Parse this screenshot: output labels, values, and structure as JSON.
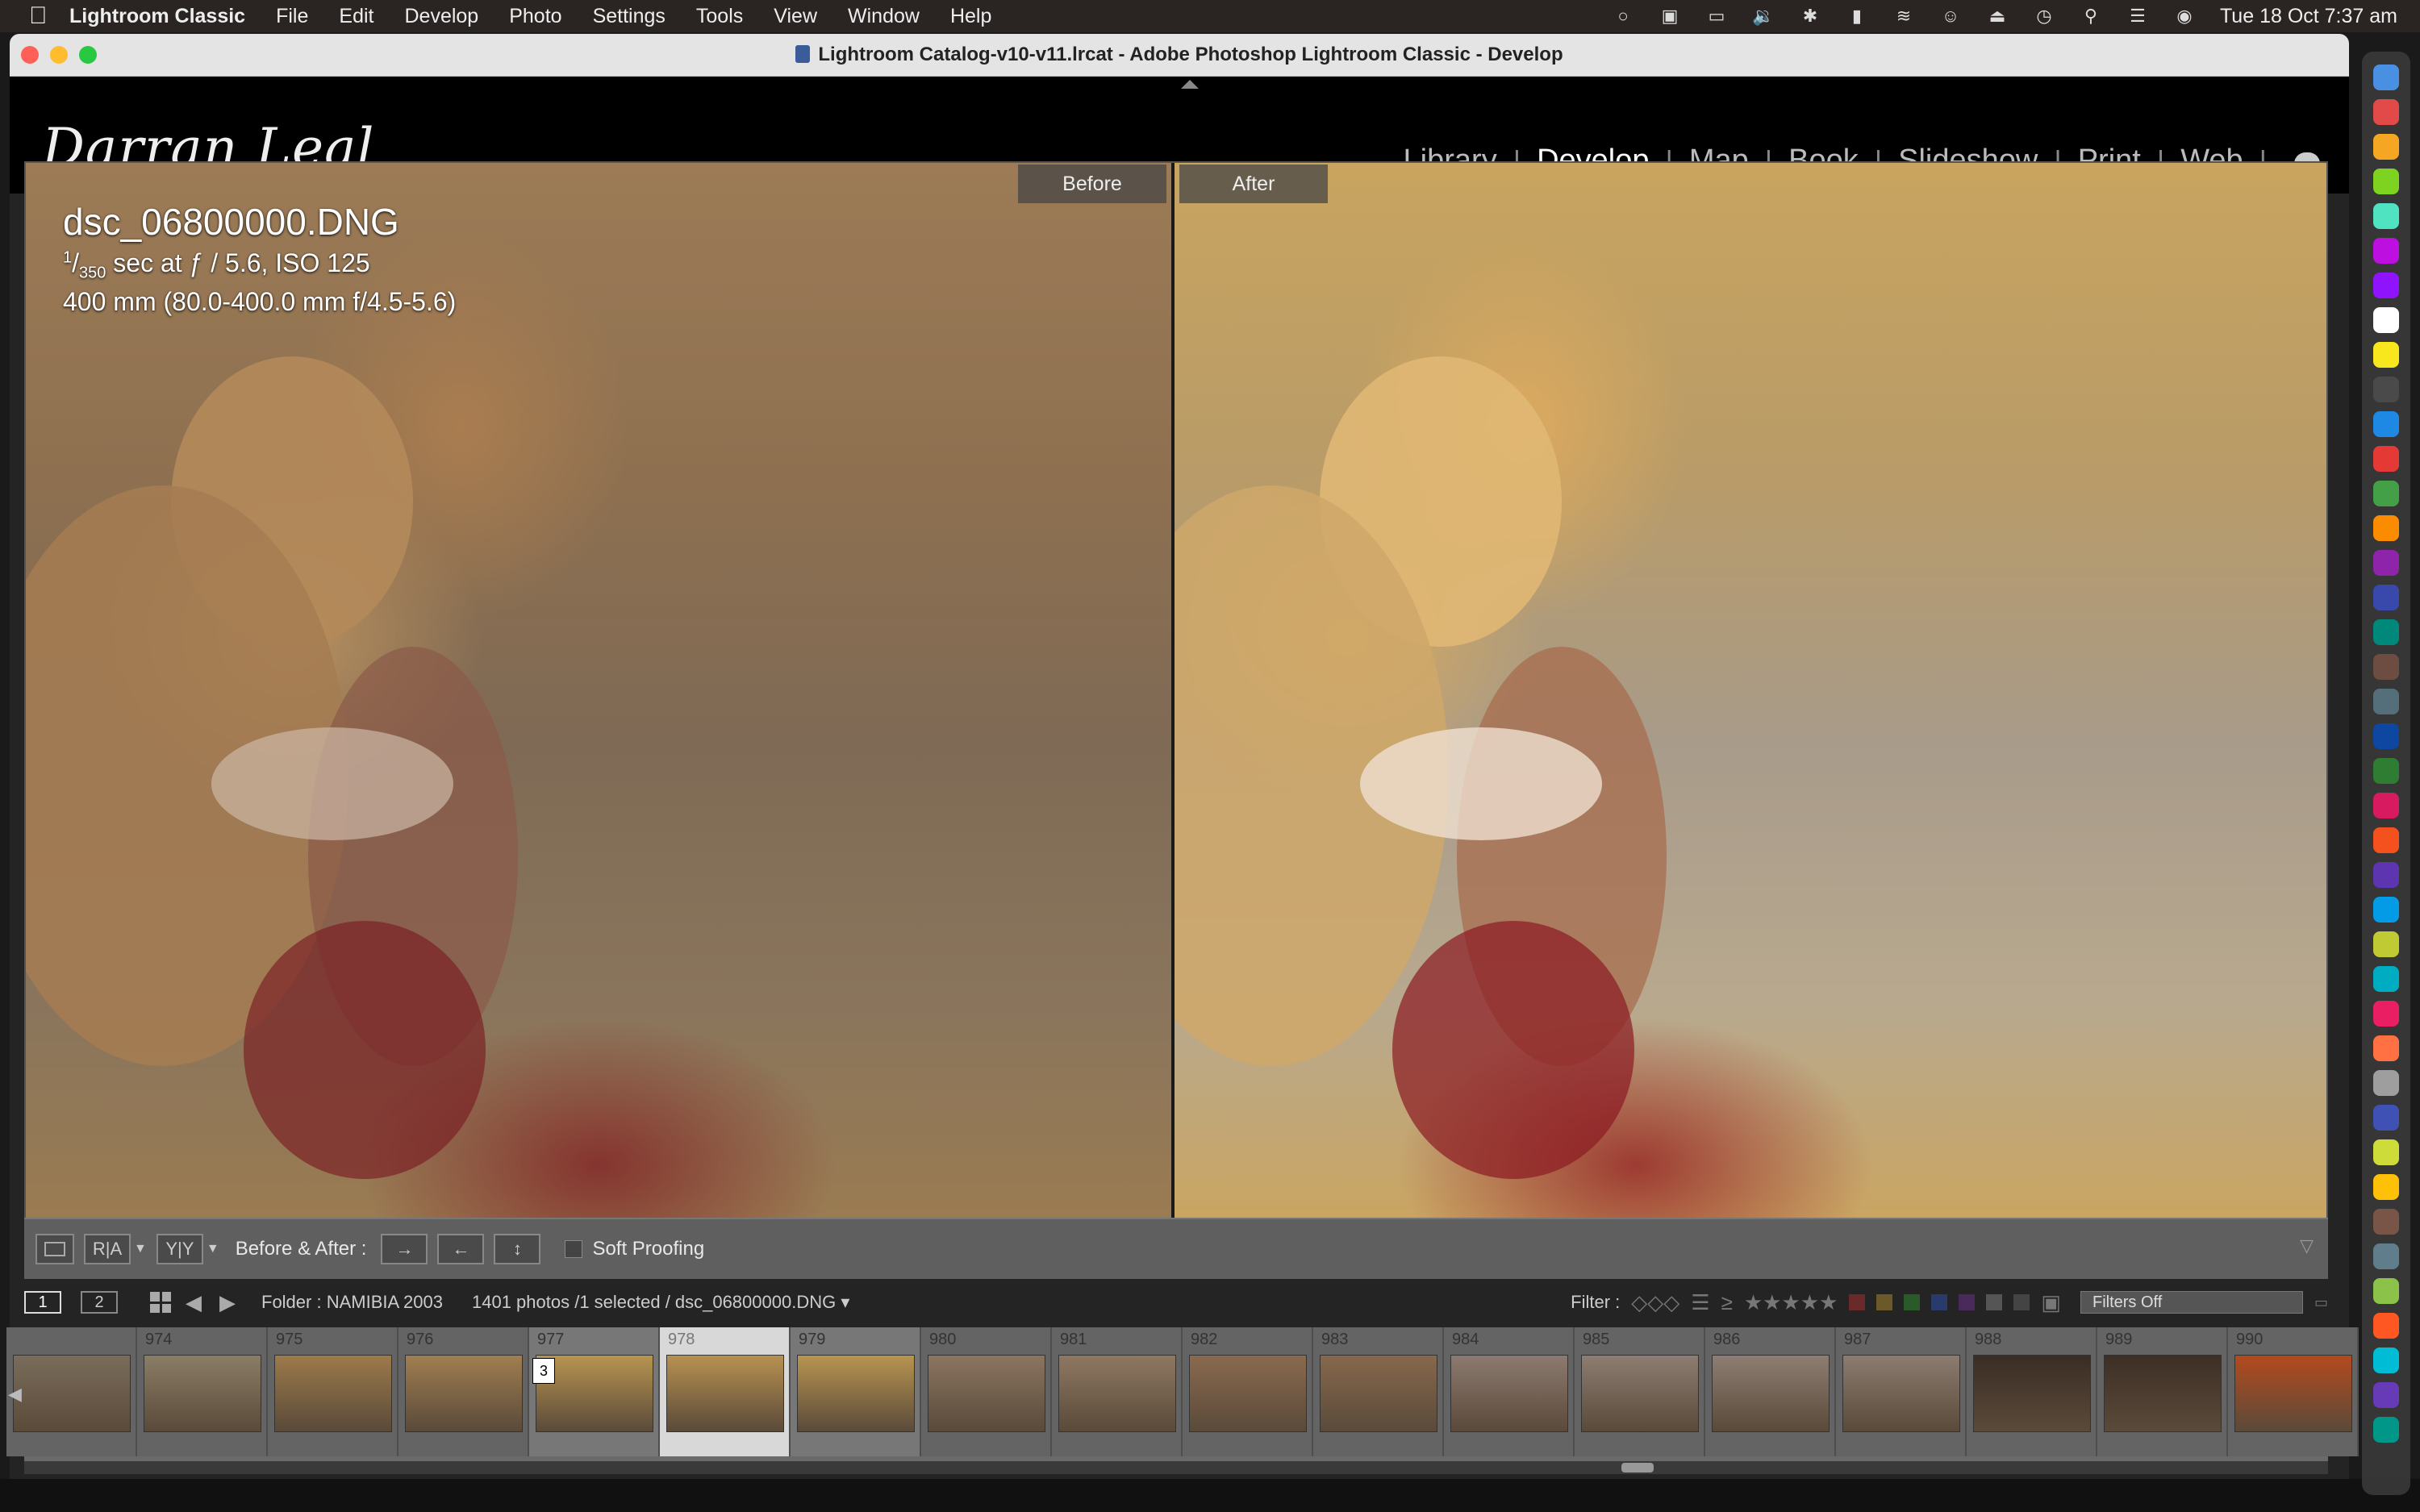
{
  "menubar": {
    "app_name": "Lightroom Classic",
    "items": [
      "File",
      "Edit",
      "Develop",
      "Photo",
      "Settings",
      "Tools",
      "View",
      "Window",
      "Help"
    ],
    "datetime": "Tue 18 Oct  7:37 am",
    "status_icons": [
      "creative-cloud-icon",
      "stage-manager-icon",
      "display-icon",
      "volume-icon",
      "bluetooth-icon",
      "battery-icon",
      "wifi-icon",
      "user-icon",
      "eject-icon",
      "time-machine-icon",
      "search-icon",
      "control-center-icon",
      "siri-icon"
    ]
  },
  "window": {
    "title": "Lightroom Catalog-v10-v11.lrcat - Adobe Photoshop Lightroom Classic - Develop"
  },
  "identity": {
    "logo_text": "Darran Leal",
    "modules": [
      "Library",
      "Develop",
      "Map",
      "Book",
      "Slideshow",
      "Print",
      "Web"
    ],
    "active_module": "Develop"
  },
  "view": {
    "before_label": "Before",
    "after_label": "After",
    "filename": "dsc_06800000.DNG",
    "exposure_num": "1",
    "exposure_den": "350",
    "exposure_rest": " sec at ƒ / 5.6, ISO 125",
    "lens": "400 mm (80.0-400.0 mm f/4.5-5.6)"
  },
  "toolbar": {
    "ra_label": "R|A",
    "yy_label": "Y|Y",
    "before_after_label": "Before & After :",
    "swap_right": "→",
    "swap_left": "←",
    "copy_label": "↕",
    "soft_proofing_label": "Soft Proofing"
  },
  "filmstrip_bar": {
    "page1": "1",
    "page2": "2",
    "folder_text": "Folder : NAMIBIA 2003",
    "count_text": "1401 photos /1 selected /",
    "selected_file": "dsc_06800000.DNG ▾",
    "filter_label": "Filter :",
    "filters_off": "Filters Off"
  },
  "filmstrip": {
    "frames": [
      {
        "num": "",
        "tone": "#7a6c5a"
      },
      {
        "num": "974",
        "tone": "#8a7d66"
      },
      {
        "num": "975",
        "tone": "#9c7a4a"
      },
      {
        "num": "976",
        "tone": "#a07e50"
      },
      {
        "num": "977",
        "tone": "#b8944f"
      },
      {
        "num": "978",
        "tone": "#b89150"
      },
      {
        "num": "979",
        "tone": "#b8944f"
      },
      {
        "num": "980",
        "tone": "#8a7560"
      },
      {
        "num": "981",
        "tone": "#8e7862"
      },
      {
        "num": "982",
        "tone": "#8a6a4e"
      },
      {
        "num": "983",
        "tone": "#86684c"
      },
      {
        "num": "984",
        "tone": "#8c7a70"
      },
      {
        "num": "985",
        "tone": "#8d7d72"
      },
      {
        "num": "986",
        "tone": "#8e7d72"
      },
      {
        "num": "987",
        "tone": "#8c7c70"
      },
      {
        "num": "988",
        "tone": "#3a2d24"
      },
      {
        "num": "989",
        "tone": "#3e2f26"
      },
      {
        "num": "990",
        "tone": "#b34a1e"
      }
    ],
    "stack_badge": "3"
  }
}
